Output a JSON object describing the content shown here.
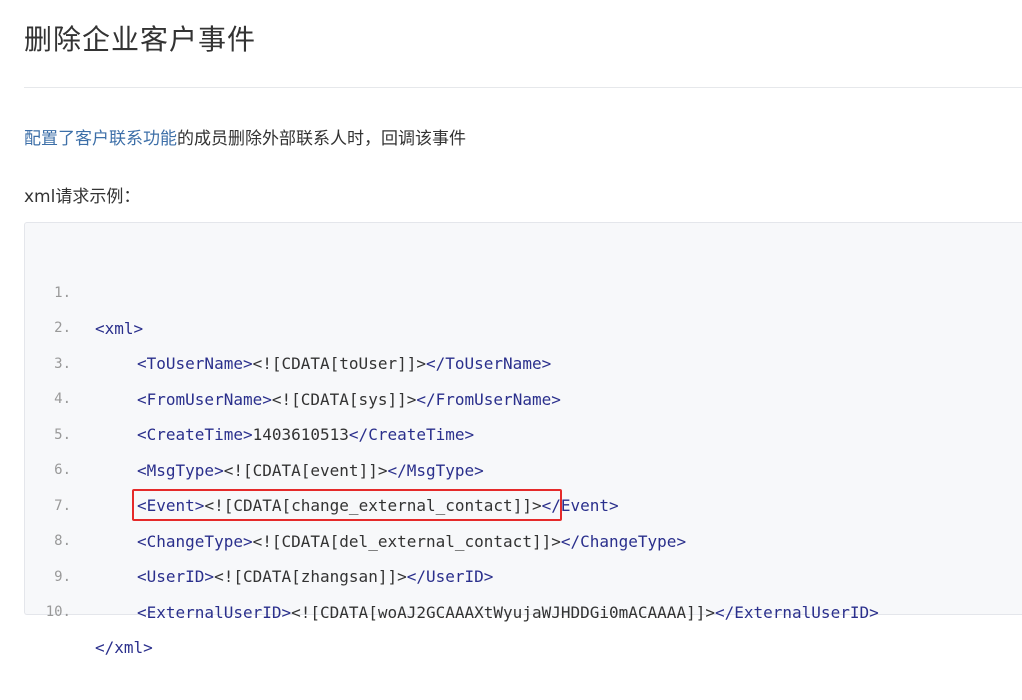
{
  "page": {
    "title": "删除企业客户事件",
    "description_link": "配置了客户联系功能",
    "description_rest": "的成员删除外部联系人时，回调该事件",
    "example_label": "xml请求示例："
  },
  "code": {
    "lines": [
      {
        "no": "1.",
        "indent": false,
        "open": "<xml>",
        "value": "",
        "close": ""
      },
      {
        "no": "2.",
        "indent": true,
        "open": "<ToUserName>",
        "value": "<![CDATA[toUser]]>",
        "close": "</ToUserName>"
      },
      {
        "no": "3.",
        "indent": true,
        "open": "<FromUserName>",
        "value": "<![CDATA[sys]]>",
        "close": "</FromUserName>"
      },
      {
        "no": "4.",
        "indent": true,
        "open": "<CreateTime>",
        "value": "1403610513",
        "close": "</CreateTime>"
      },
      {
        "no": "5.",
        "indent": true,
        "open": "<MsgType>",
        "value": "<![CDATA[event]]>",
        "close": "</MsgType>"
      },
      {
        "no": "6.",
        "indent": true,
        "open": "<Event>",
        "value": "<![CDATA[change_external_contact]]>",
        "close": "</Event>"
      },
      {
        "no": "7.",
        "indent": true,
        "open": "<ChangeType>",
        "value": "<![CDATA[del_external_contact]]>",
        "close": "</ChangeType>"
      },
      {
        "no": "8.",
        "indent": true,
        "open": "<UserID>",
        "value": "<![CDATA[zhangsan]]>",
        "close": "</UserID>"
      },
      {
        "no": "9.",
        "indent": true,
        "open": "<ExternalUserID>",
        "value": "<![CDATA[woAJ2GCAAAXtWyujaWJHDDGi0mACAAAA]]>",
        "close": "</ExternalUserID>"
      },
      {
        "no": "10.",
        "indent": false,
        "open": "</xml>",
        "value": "",
        "close": ""
      }
    ],
    "highlighted_line": "8."
  },
  "colors": {
    "link": "#3d6fa8",
    "tag": "#2a2f8c",
    "highlight_border": "#e52a2a",
    "code_background": "#f7f8fa"
  }
}
